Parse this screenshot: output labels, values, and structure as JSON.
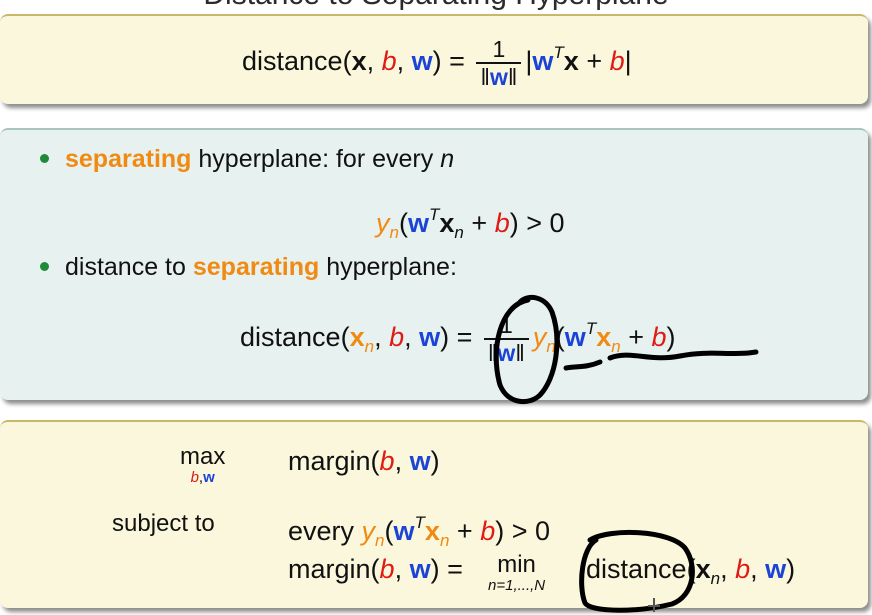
{
  "title": "Distance to Separating Hyperplane",
  "box1": {
    "lhs": "distance(",
    "x": "x",
    "b": "b",
    "w": "w",
    "frac_num": "1",
    "T": "T",
    "plus": "+"
  },
  "box2": {
    "bullet1_word": "separating",
    "bullet1_rest": " hyperplane: for every ",
    "bullet1_n": "n",
    "cond_y": "y",
    "cond_n": "n",
    "cond_tail": ") > 0",
    "bullet2_start": "distance to ",
    "bullet2_word": "separating",
    "bullet2_end": " hyperplane:",
    "dist_lhs": "distance(",
    "frac_num": "1"
  },
  "box3": {
    "max": "max",
    "max_sub_b": "b",
    "max_sub_w": "w",
    "objective": "margin(",
    "subject_to": "subject to",
    "every": "every ",
    "margin_eq": "margin(",
    "min": "min",
    "min_sub": "n=1,...,N",
    "distance": "distance("
  }
}
